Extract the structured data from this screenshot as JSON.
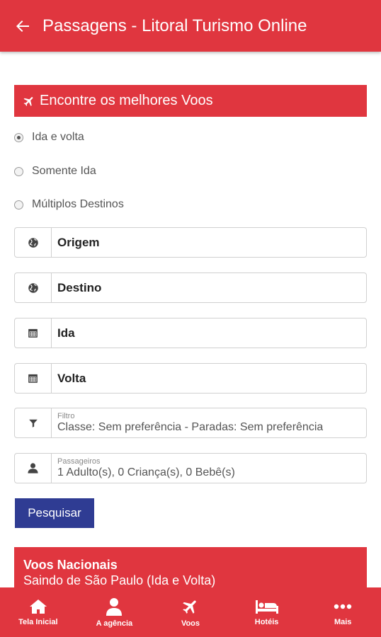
{
  "header": {
    "title": "Passagens - Litoral Turismo Online",
    "back_icon": "arrow-left-icon"
  },
  "colors": {
    "primary": "#e0363f",
    "button": "#2f3c93"
  },
  "search": {
    "section_title": "Encontre os melhores Voos",
    "trip_types": [
      {
        "label": "Ida e volta",
        "checked": true
      },
      {
        "label": "Somente Ida",
        "checked": false
      },
      {
        "label": "Múltiplos Destinos",
        "checked": false
      }
    ],
    "origin": "Origem",
    "destination": "Destino",
    "departure": "Ida",
    "return": "Volta",
    "filter_label": "Filtro",
    "filter_value": "Classe: Sem preferência - Paradas: Sem preferência",
    "passengers_label": "Passageiros",
    "passengers_value": "1 Adulto(s), 0 Criança(s), 0 Bebê(s)",
    "search_button": "Pesquisar"
  },
  "promo": {
    "title": "Voos Nacionais",
    "subtitle": "Saindo de São Paulo (Ida e Volta)"
  },
  "bottom_nav": [
    {
      "label": "Tela Inicial",
      "icon": "home-icon"
    },
    {
      "label": "A agência",
      "icon": "user-icon"
    },
    {
      "label": "Voos",
      "icon": "plane-icon"
    },
    {
      "label": "Hotéis",
      "icon": "bed-icon"
    },
    {
      "label": "Mais",
      "icon": "more-icon"
    }
  ]
}
